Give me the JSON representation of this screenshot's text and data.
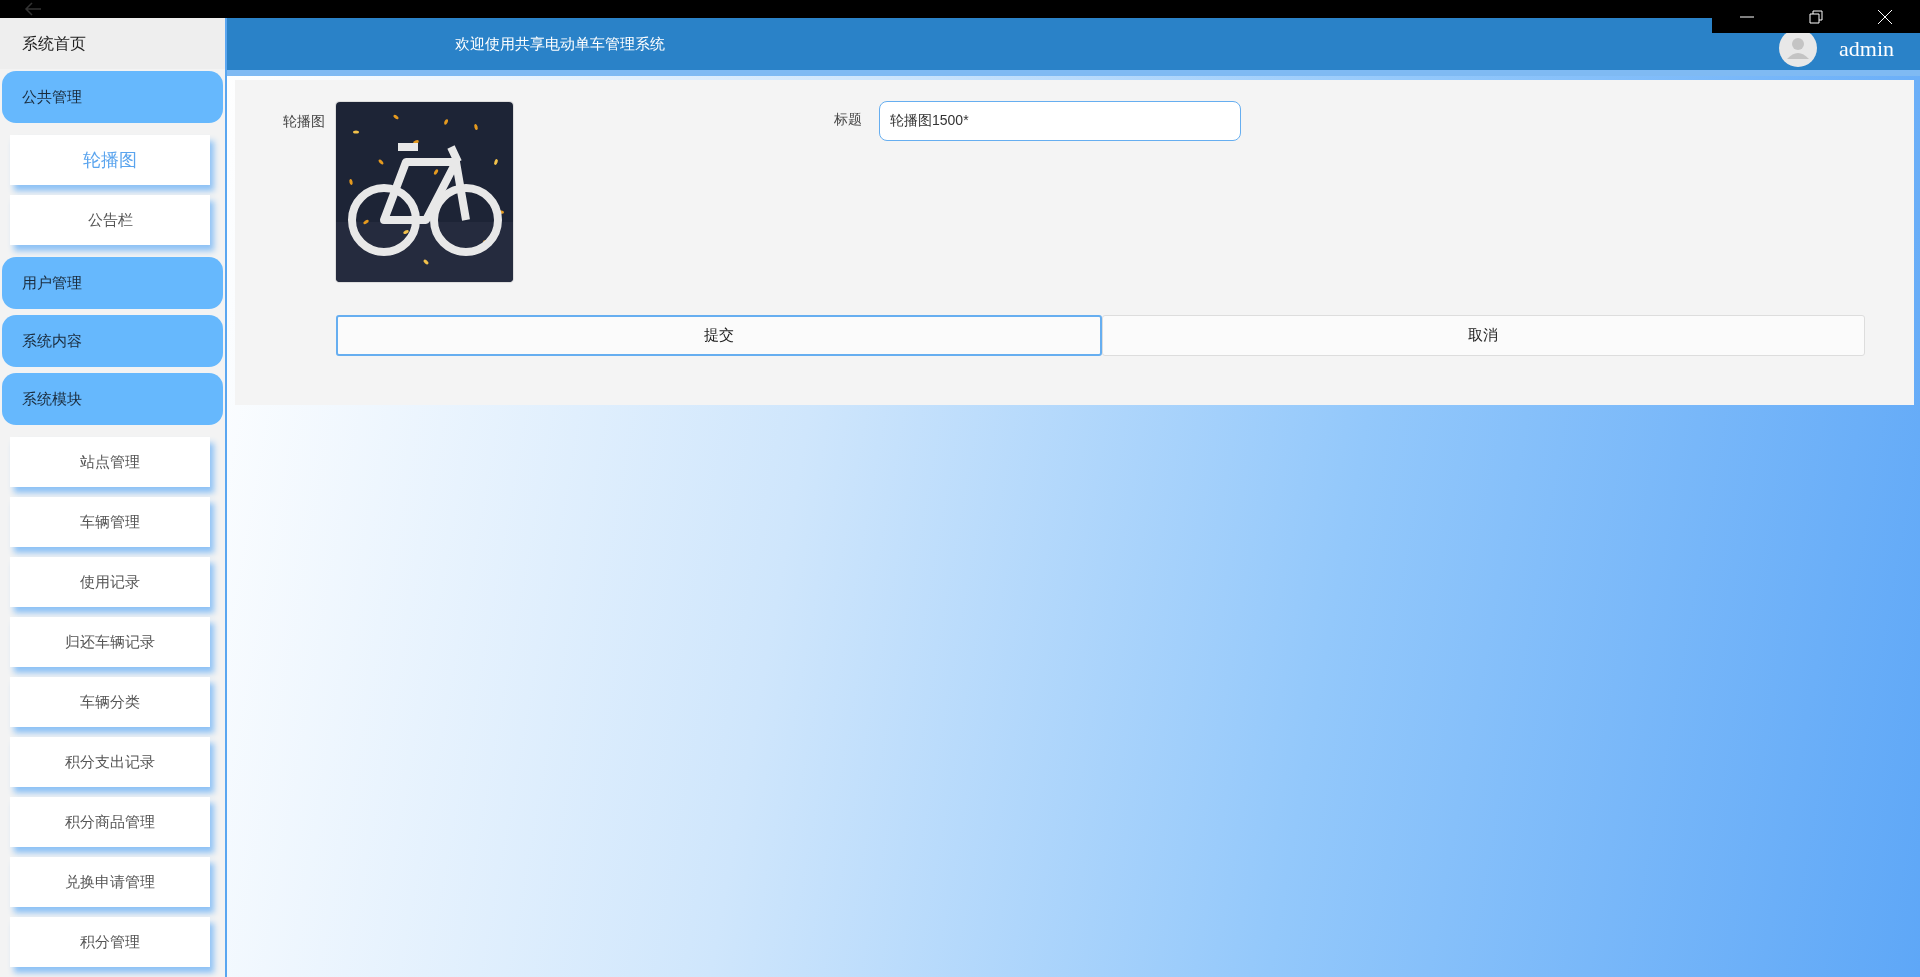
{
  "header": {
    "title": "欢迎使用共享电动单车管理系统",
    "user": "admin"
  },
  "sidebar": {
    "home": "系统首页",
    "groups": [
      {
        "label": "公共管理",
        "children": [
          {
            "label": "轮播图",
            "selected": true
          },
          {
            "label": "公告栏",
            "selected": false
          }
        ]
      },
      {
        "label": "用户管理"
      },
      {
        "label": "系统内容"
      },
      {
        "label": "系统模块",
        "children": [
          {
            "label": "站点管理",
            "selected": false
          },
          {
            "label": "车辆管理",
            "selected": false
          },
          {
            "label": "使用记录",
            "selected": false
          },
          {
            "label": "归还车辆记录",
            "selected": false
          },
          {
            "label": "车辆分类",
            "selected": false
          },
          {
            "label": "积分支出记录",
            "selected": false
          },
          {
            "label": "积分商品管理",
            "selected": false
          },
          {
            "label": "兑换申请管理",
            "selected": false
          },
          {
            "label": "积分管理",
            "selected": false
          }
        ]
      }
    ]
  },
  "form": {
    "image_label": "轮播图",
    "title_label": "标题",
    "title_value": "轮播图1500*"
  },
  "buttons": [
    {
      "label": "提交",
      "selected": true
    },
    {
      "label": "取消",
      "selected": false
    }
  ]
}
